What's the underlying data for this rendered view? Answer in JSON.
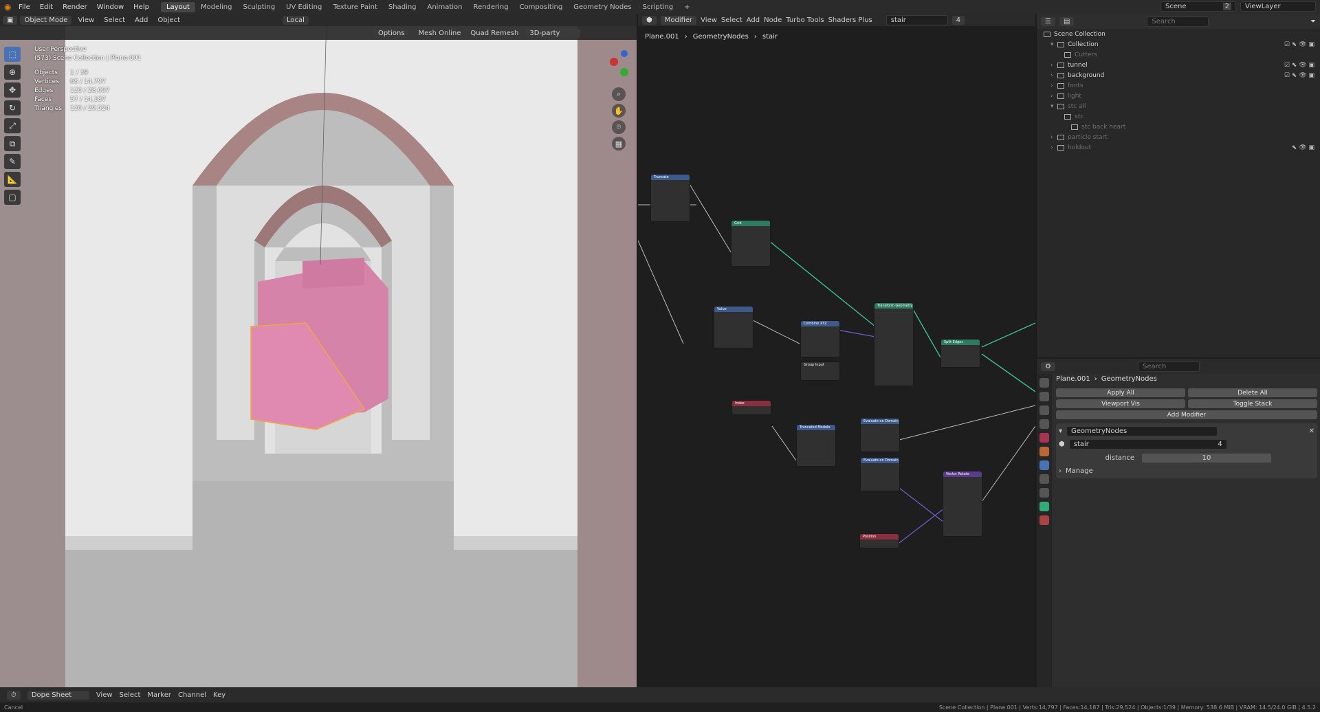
{
  "topbar": {
    "menus": [
      "File",
      "Edit",
      "Render",
      "Window",
      "Help"
    ],
    "workspaces": [
      "Layout",
      "Modeling",
      "Sculpting",
      "UV Editing",
      "Texture Paint",
      "Shading",
      "Animation",
      "Rendering",
      "Compositing",
      "Geometry Nodes",
      "Scripting"
    ],
    "active_workspace": "Layout",
    "scene": "Scene",
    "scene_count": "2",
    "view_layer": "ViewLayer"
  },
  "viewport": {
    "mode": "Object Mode",
    "menus": [
      "View",
      "Select",
      "Add",
      "Object"
    ],
    "orientation": "Local",
    "options_label": "Options",
    "mesh_online": "Mesh Online",
    "quad_remesh": "Quad Remesh",
    "party": "3D-party",
    "info_title": "User Perspective",
    "info_collection": "(573) Scene Collection | Plane.001",
    "stats": [
      {
        "k": "Objects",
        "v": "1 / 39"
      },
      {
        "k": "Vertices",
        "v": "68 / 14,797"
      },
      {
        "k": "Edges",
        "v": "120 / 28,057"
      },
      {
        "k": "Faces",
        "v": "57 / 14,187"
      },
      {
        "k": "Triangles",
        "v": "120 / 29,524"
      }
    ]
  },
  "node_editor": {
    "editor_type": "Modifier",
    "menus": [
      "View",
      "Select",
      "Add",
      "Node",
      "Turbo Tools",
      "Shaders Plus"
    ],
    "node_group": "stair",
    "users": "4",
    "breadcrumb": [
      "Plane.001",
      "GeometryNodes",
      "stair"
    ],
    "nodes": [
      {
        "title": "Truncate",
        "color": "#3d5a8a"
      },
      {
        "title": "Grid",
        "color": "#2f7a62"
      },
      {
        "title": "Value",
        "color": "#3d5a8a"
      },
      {
        "title": "Combine XYZ",
        "color": "#3d5a8a"
      },
      {
        "title": "Transform Geometry",
        "color": "#2f7a62"
      },
      {
        "title": "Group Input",
        "color": "#303030"
      },
      {
        "title": "Split Edges",
        "color": "#2f7a62"
      },
      {
        "title": "Index",
        "color": "#8a2f3f"
      },
      {
        "title": "Truncated Modulo",
        "color": "#3d5a8a"
      },
      {
        "title": "Evaluate on Domain",
        "color": "#3d5a8a"
      },
      {
        "title": "Evaluate on Domain",
        "color": "#3d5a8a"
      },
      {
        "title": "Vector Rotate",
        "color": "#5a3d8a"
      },
      {
        "title": "Position",
        "color": "#8a2f3f"
      }
    ]
  },
  "outliner": {
    "search_placeholder": "Search",
    "root": "Scene Collection",
    "items": [
      {
        "name": "Collection",
        "dim": false
      },
      {
        "name": "Cutters",
        "dim": true
      },
      {
        "name": "tunnel",
        "dim": false
      },
      {
        "name": "background",
        "dim": false
      },
      {
        "name": "fonts",
        "dim": true
      },
      {
        "name": "light",
        "dim": true
      },
      {
        "name": "stc all",
        "dim": true
      },
      {
        "name": "stc",
        "dim": true
      },
      {
        "name": "stc back heart",
        "dim": true
      },
      {
        "name": "particle start",
        "dim": true
      },
      {
        "name": "holdout",
        "dim": true
      }
    ]
  },
  "properties": {
    "search_placeholder": "Search",
    "breadcrumb": [
      "Plane.001",
      "GeometryNodes"
    ],
    "apply_all": "Apply All",
    "delete_all": "Delete All",
    "viewport_vis": "Viewport Vis",
    "toggle_stack": "Toggle Stack",
    "add_modifier": "Add Modifier",
    "modifier_name": "GeometryNodes",
    "node_group": "stair",
    "node_group_users": "4",
    "distance_label": "distance",
    "distance_value": "10",
    "manage_label": "Manage"
  },
  "timeline": {
    "editor": "Dope Sheet",
    "menus": [
      "View",
      "Select",
      "Marker",
      "Channel",
      "Key"
    ]
  },
  "status": {
    "left": "Cancel",
    "right": "Scene Collection | Plane.001 | Verts:14,797 | Faces:14,187 | Tris:29,524 | Objects:1/39 | Memory: 538.6 MiB | VRAM: 14.5/24.0 GiB | 4.5.2"
  },
  "colors": {
    "accent": "#4772b3",
    "stair_pink": "#d9739f",
    "node_link": "#3fbf8f"
  }
}
